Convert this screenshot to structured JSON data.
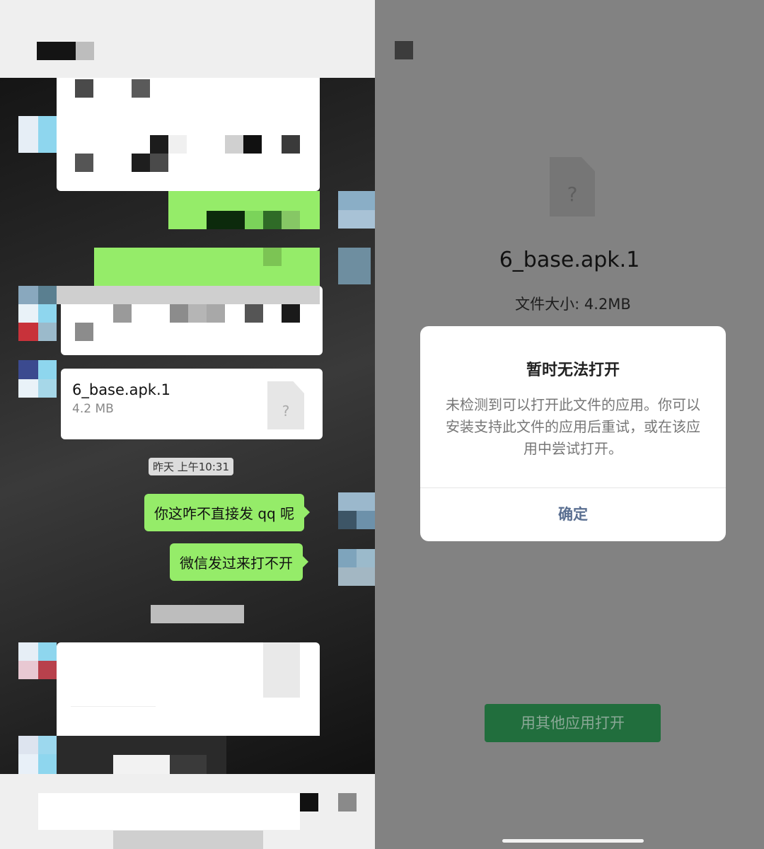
{
  "left_chat": {
    "file_message": {
      "name": "6_base.apk.1",
      "size": "4.2 MB",
      "icon": "unknown-file-icon",
      "icon_glyph": "?"
    },
    "timestamp": "昨天 上午10:31",
    "messages": [
      {
        "text": "你这咋不直接发 qq 呢"
      },
      {
        "text": "微信发过来打不开"
      }
    ]
  },
  "file_preview": {
    "back_icon": "back-icon",
    "file_icon_glyph": "?",
    "file_name": "6_base.apk.1",
    "file_size_label": "文件大小: 4.2MB",
    "open_with_other_label": "用其他应用打开"
  },
  "dialog": {
    "title": "暂时无法打开",
    "message": "未检测到可以打开此文件的应用。你可以安装支持此文件的应用后重试，或在该应用中尝试打开。",
    "confirm_label": "确定"
  },
  "colors": {
    "chat_bubble_green": "#95ec69",
    "dialog_button_text": "#5a6f91",
    "open_other_button_bg": "#216e3d"
  }
}
